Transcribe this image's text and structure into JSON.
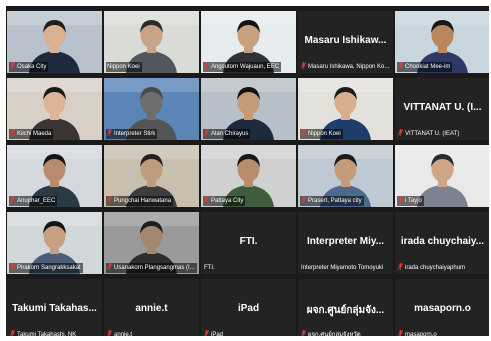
{
  "meeting": {
    "accent_color": "#d8d632",
    "muted_color": "#e03b3b",
    "participants": [
      {
        "name": "Osaka City",
        "display": "",
        "muted": true,
        "video": true,
        "active": false,
        "bg": "#b9c2cc",
        "skin": "#d9b191",
        "shirt": "#1f2a3f",
        "hair": "#1d1d1d"
      },
      {
        "name": "Nippon Koei",
        "display": "",
        "muted": false,
        "video": true,
        "active": true,
        "bg": "#d9dcd6",
        "skin": "#c8a386",
        "shirt": "#51575d",
        "hair": "#2b2b2b"
      },
      {
        "name": "Angsutorn Wajuaun, EEC",
        "display": "",
        "muted": true,
        "video": true,
        "active": false,
        "bg": "#e6ebee",
        "skin": "#c9a07e",
        "shirt": "#2f3134",
        "hair": "#121212"
      },
      {
        "name": "Masaru Ishikawa, Nippon Ko...",
        "display": "Masaru  Ishikaw...",
        "muted": true,
        "video": false,
        "active": false
      },
      {
        "name": "Chookiat Mee-im",
        "display": "",
        "muted": true,
        "video": true,
        "active": false,
        "bg": "#c9d6dd",
        "skin": "#b8875e",
        "shirt": "#2e3a66",
        "hair": "#171717"
      },
      {
        "name": "Kiichi Maeda",
        "display": "",
        "muted": true,
        "video": true,
        "active": false,
        "bg": "#d8cfc7",
        "skin": "#ddb497",
        "shirt": "#3b3433",
        "hair": "#1a1a1a"
      },
      {
        "name": "Interpreter Stirk",
        "display": "",
        "muted": true,
        "video": true,
        "active": false,
        "bg": "#5a86b7",
        "skin": "#6e6e6e",
        "shirt": "#555555",
        "hair": "#4a4a4a"
      },
      {
        "name": "Alan Chirayus",
        "display": "",
        "muted": true,
        "video": true,
        "active": false,
        "bg": "#b7bfc8",
        "skin": "#c59a77",
        "shirt": "#1d2a3d",
        "hair": "#141414"
      },
      {
        "name": "Nippon Koei",
        "display": "",
        "muted": true,
        "video": true,
        "active": false,
        "bg": "#e3e1dc",
        "skin": "#d8ae8e",
        "shirt": "#1e3d6b",
        "hair": "#1c1c1c"
      },
      {
        "name": "VITTANAT U. (IEAT)",
        "display": "VITTANAT U. (I...",
        "muted": true,
        "video": false,
        "active": false
      },
      {
        "name": "Anuphar_EEC",
        "display": "",
        "muted": true,
        "video": true,
        "active": false,
        "bg": "#d4d7dc",
        "skin": "#b78c6c",
        "shirt": "#2a3a44",
        "hair": "#151515"
      },
      {
        "name": "Pungchai Hanwatana",
        "display": "",
        "muted": true,
        "video": true,
        "active": false,
        "bg": "#c9bfae",
        "skin": "#bf9c7c",
        "shirt": "#3d3d3d",
        "hair": "#222222"
      },
      {
        "name": "Pattaya City",
        "display": "",
        "muted": true,
        "video": true,
        "active": false,
        "bg": "#cfd0cf",
        "skin": "#b98d6b",
        "shirt": "#3f5d3d",
        "hair": "#161616"
      },
      {
        "name": "Prasert, Pattaya city",
        "display": "",
        "muted": true,
        "video": true,
        "active": false,
        "bg": "#bfc9d3",
        "skin": "#c49c7a",
        "shirt": "#4d6a8c",
        "hair": "#1b1b1b"
      },
      {
        "name": "i Tayjo",
        "display": "",
        "muted": true,
        "video": true,
        "active": false,
        "bg": "#e9e9ea",
        "skin": "#cfa487",
        "shirt": "#7b8390",
        "hair": "#2a2a2a"
      },
      {
        "name": "Pirakorn Sangrakksakat",
        "display": "",
        "muted": true,
        "video": true,
        "active": false,
        "bg": "#d2d7d9",
        "skin": "#c79f82",
        "shirt": "#4b5d78",
        "hair": "#151515"
      },
      {
        "name": "Usanakorn Plangsangmas (I...",
        "display": "",
        "muted": true,
        "video": true,
        "active": false,
        "bg": "#9a9a9a",
        "skin": "#a3876f",
        "shirt": "#2d2d2d",
        "hair": "#1e1e1e"
      },
      {
        "name": "FTI.",
        "display": "FTI.",
        "muted": false,
        "video": false,
        "active": false
      },
      {
        "name": "Interpreter Miyamoto Tomoyuki",
        "display": "Interpreter  Miy...",
        "muted": false,
        "video": false,
        "active": false
      },
      {
        "name": "irada chuychaiyaphum",
        "display": "irada  chuychaiy...",
        "muted": true,
        "video": false,
        "active": false
      },
      {
        "name": "Takumi Takahashi, NK",
        "display": "Takumi  Takahas...",
        "muted": true,
        "video": false,
        "active": false
      },
      {
        "name": "annie.t",
        "display": "annie.t",
        "muted": true,
        "video": false,
        "active": false
      },
      {
        "name": "iPad",
        "display": "iPad",
        "muted": true,
        "video": false,
        "active": false
      },
      {
        "name": "ผจก.ศูนย์กลุ่มจังหวัด",
        "display": "ผจก.ศูนย์กลุ่มจัง...",
        "muted": true,
        "video": false,
        "active": false
      },
      {
        "name": "masaporn.o",
        "display": "masaporn.o",
        "muted": true,
        "video": false,
        "active": false
      }
    ]
  }
}
